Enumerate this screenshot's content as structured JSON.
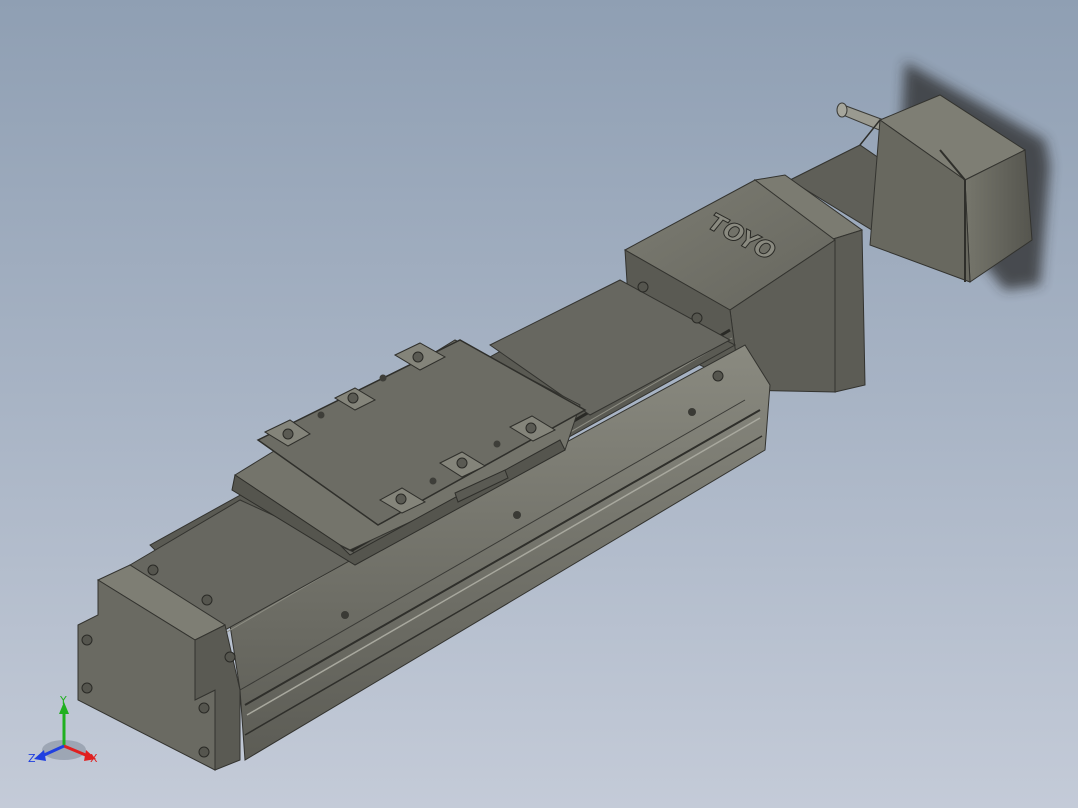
{
  "viewport": {
    "background_top": "#8f9fb3",
    "background_bottom": "#c4cbd8",
    "model_body_color": "#6e6e66",
    "model_dark_color": "#4e4e48",
    "model_light_color": "#8a8a80"
  },
  "model": {
    "brand_logo_text": "TOYO"
  },
  "triad": {
    "x_label": "X",
    "y_label": "Y",
    "z_label": "Z",
    "x_color": "#e02020",
    "y_color": "#20b020",
    "z_color": "#2040e0"
  }
}
